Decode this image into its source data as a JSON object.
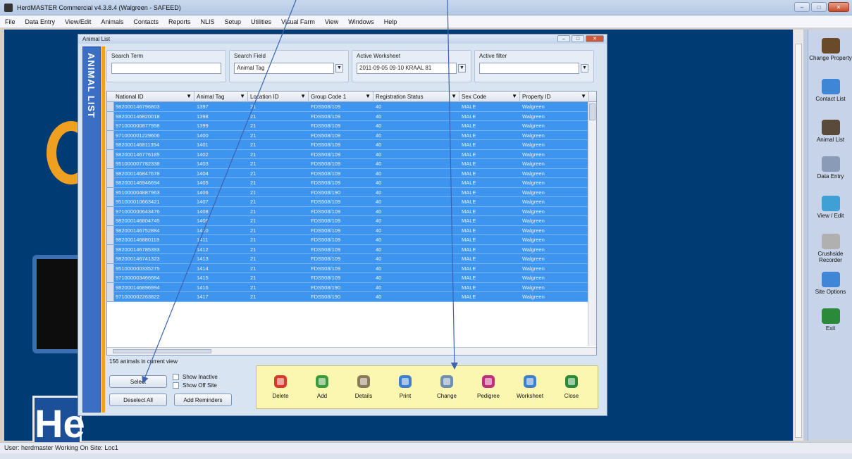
{
  "window": {
    "title": "HerdMASTER Commercial v4.3.8.4 (Walgreen - SAFEED)",
    "controls": [
      "–",
      "□",
      "✕"
    ]
  },
  "menu": [
    "File",
    "Data Entry",
    "View/Edit",
    "Animals",
    "Contacts",
    "Reports",
    "NLIS",
    "Setup",
    "Utilities",
    "Visual Farm",
    "View",
    "Windows",
    "Help"
  ],
  "child": {
    "title": "Animal List",
    "sidetab": "ANIMAL LIST",
    "filters": {
      "search_term": {
        "label": "Search Term",
        "value": ""
      },
      "search_field": {
        "label": "Search Field",
        "value": "Animal Tag"
      },
      "active_worksheet": {
        "label": "Active Worksheet",
        "value": "2011-09-05 09-10 KRAAL 81"
      },
      "active_filter": {
        "label": "Active filter",
        "value": ""
      }
    },
    "columns": [
      "National ID",
      "Animal Tag",
      "Location ID",
      "Group Code 1",
      "Registration Status",
      "Sex Code",
      "Property ID"
    ],
    "rows": [
      [
        "982000146796803",
        "1397",
        "21",
        "FDS508/109",
        "40",
        "MALE",
        "Walgreen"
      ],
      [
        "982000146820018",
        "1398",
        "21",
        "FDS508/109",
        "40",
        "MALE",
        "Walgreen"
      ],
      [
        "971000000877958",
        "1399",
        "21",
        "FDS508/109",
        "40",
        "MALE",
        "Walgreen"
      ],
      [
        "971000001229606",
        "1400",
        "21",
        "FDS508/109",
        "40",
        "MALE",
        "Walgreen"
      ],
      [
        "982000146811354",
        "1401",
        "21",
        "FDS508/109",
        "40",
        "MALE",
        "Walgreen"
      ],
      [
        "982000146776185",
        "1402",
        "21",
        "FDS508/109",
        "40",
        "MALE",
        "Walgreen"
      ],
      [
        "951000007782338",
        "1403",
        "21",
        "FDS508/109",
        "40",
        "MALE",
        "Walgreen"
      ],
      [
        "982000146847678",
        "1404",
        "21",
        "FDS508/109",
        "40",
        "MALE",
        "Walgreen"
      ],
      [
        "982000146946694",
        "1405",
        "21",
        "FDS508/109",
        "40",
        "MALE",
        "Walgreen"
      ],
      [
        "951000004887963",
        "1406",
        "21",
        "FDS508/190",
        "40",
        "MALE",
        "Walgreen"
      ],
      [
        "951000010663421",
        "1407",
        "21",
        "FDS508/109",
        "40",
        "MALE",
        "Walgreen"
      ],
      [
        "971000000643476",
        "1408",
        "21",
        "FDS508/109",
        "40",
        "MALE",
        "Walgreen"
      ],
      [
        "982000146804745",
        "1409",
        "21",
        "FDS508/109",
        "40",
        "MALE",
        "Walgreen"
      ],
      [
        "982000146752884",
        "1410",
        "21",
        "FDS508/109",
        "40",
        "MALE",
        "Walgreen"
      ],
      [
        "982000146880119",
        "1411",
        "21",
        "FDS508/109",
        "40",
        "MALE",
        "Walgreen"
      ],
      [
        "982000146785393",
        "1412",
        "21",
        "FDS508/109",
        "40",
        "MALE",
        "Walgreen"
      ],
      [
        "982000146741323",
        "1413",
        "21",
        "FDS508/109",
        "40",
        "MALE",
        "Walgreen"
      ],
      [
        "951000000335275",
        "1414",
        "21",
        "FDS508/109",
        "40",
        "MALE",
        "Walgreen"
      ],
      [
        "971000003466684",
        "1415",
        "21",
        "FDS508/109",
        "40",
        "MALE",
        "Walgreen"
      ],
      [
        "982000146896994",
        "1416",
        "21",
        "FDS508/190",
        "40",
        "MALE",
        "Walgreen"
      ],
      [
        "971000002263822",
        "1417",
        "21",
        "FDS508/190",
        "40",
        "MALE",
        "Walgreen"
      ]
    ],
    "count_label": "156 animals in current view",
    "buttons": {
      "select": "Select",
      "deselect_all": "Deselect All",
      "add_reminders": "Add Reminders",
      "show_inactive": "Show Inactive",
      "show_off_site": "Show Off Site"
    },
    "toolbar": [
      {
        "label": "Delete",
        "icon": "delete-icon",
        "color": "#d83a2a"
      },
      {
        "label": "Add",
        "icon": "add-icon",
        "color": "#3a9b3a"
      },
      {
        "label": "Details",
        "icon": "details-icon",
        "color": "#8a7a5a"
      },
      {
        "label": "Print",
        "icon": "print-icon",
        "color": "#3f7fd0"
      },
      {
        "label": "Change",
        "icon": "change-icon",
        "color": "#6f8fb0"
      },
      {
        "label": "Pedigree",
        "icon": "pedigree-icon",
        "color": "#c0307a"
      },
      {
        "label": "Worksheet",
        "icon": "worksheet-icon",
        "color": "#3f7fd0"
      },
      {
        "label": "Close",
        "icon": "exit-icon",
        "color": "#2a8a3a"
      }
    ]
  },
  "sidebar": [
    {
      "label": "Change Property",
      "icon": "change-property-icon",
      "color": "#6b4a2a"
    },
    {
      "label": "Contact List",
      "icon": "contact-list-icon",
      "color": "#3f86d6"
    },
    {
      "label": "Animal List",
      "icon": "animal-list-icon",
      "color": "#5a4a3a"
    },
    {
      "label": "Data Entry",
      "icon": "data-entry-icon",
      "color": "#8a9bb7"
    },
    {
      "label": "View / Edit",
      "icon": "view-edit-icon",
      "color": "#3fa0d6"
    },
    {
      "label": "Crushside Recorder",
      "icon": "crushside-recorder-icon",
      "color": "#b0b0b0"
    },
    {
      "label": "Site Options",
      "icon": "site-options-icon",
      "color": "#3f86d6"
    },
    {
      "label": "Exit",
      "icon": "exit-icon",
      "color": "#2a8a3a"
    }
  ],
  "status": "User: herdmaster  Working On Site: Loc1",
  "colors": {
    "workspace": "#003b73",
    "row_selected": "#3d95f0",
    "toolbar_bg": "#fbf7b0",
    "sidetab": "#3a6fc4"
  }
}
